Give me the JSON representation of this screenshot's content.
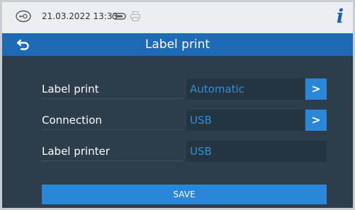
{
  "status_bar": {
    "datetime": "21.03.2022 13:33",
    "key_icon": "key-icon",
    "usb_icon": "usb-icon",
    "printer_icon": "printer-icon",
    "info_icon": "i"
  },
  "title_bar": {
    "back_icon": "back-arrow-icon",
    "title": "Label print"
  },
  "rows": [
    {
      "label": "Label print",
      "value": "Automatic",
      "has_arrow": true
    },
    {
      "label": "Connection",
      "value": "USB",
      "has_arrow": true
    },
    {
      "label": "Label printer",
      "value": "USB",
      "has_arrow": false
    }
  ],
  "arrow_glyph": ">",
  "save_label": "SAVE",
  "colors": {
    "background": "#2e3d4c",
    "title_bar": "#1f6ab4",
    "accent": "#2a86d8",
    "value_text": "#2f8fdc",
    "status_bar": "#eceef0"
  }
}
